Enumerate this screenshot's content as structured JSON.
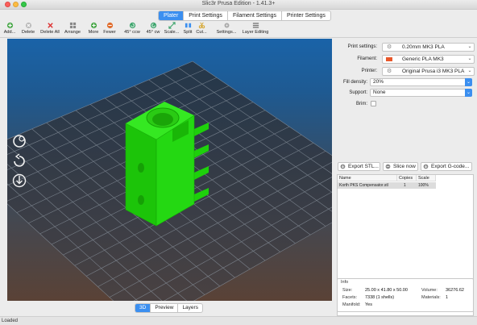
{
  "window": {
    "title": "Slic3r Prusa Edition - 1.41.3+"
  },
  "tabs": [
    {
      "label": "Plater",
      "active": true
    },
    {
      "label": "Print Settings",
      "active": false
    },
    {
      "label": "Filament Settings",
      "active": false
    },
    {
      "label": "Printer Settings",
      "active": false
    }
  ],
  "toolbar": [
    {
      "label": "Add...",
      "icon": "add-icon"
    },
    {
      "label": "Delete",
      "icon": "delete-icon"
    },
    {
      "label": "Delete All",
      "icon": "delete-all-icon"
    },
    {
      "label": "Arrange",
      "icon": "arrange-icon"
    },
    {
      "label": "More",
      "icon": "more-icon"
    },
    {
      "label": "Fewer",
      "icon": "fewer-icon"
    },
    {
      "label": "45° ccw",
      "icon": "rotate-ccw-icon"
    },
    {
      "label": "45° cw",
      "icon": "rotate-cw-icon"
    },
    {
      "label": "Scale...",
      "icon": "scale-icon"
    },
    {
      "label": "Split",
      "icon": "split-icon"
    },
    {
      "label": "Cut...",
      "icon": "cut-icon"
    },
    {
      "label": "Settings...",
      "icon": "settings-icon"
    },
    {
      "label": "Layer Editing",
      "icon": "layer-editing-icon"
    }
  ],
  "view_tabs": [
    {
      "label": "3D",
      "active": true
    },
    {
      "label": "Preview",
      "active": false
    },
    {
      "label": "Layers",
      "active": false
    }
  ],
  "status": "Loaded",
  "settings": {
    "print_label": "Print settings:",
    "print_value": "0.20mm MK3 PLA",
    "filament_label": "Filament:",
    "filament_value": "Generic PLA MK3",
    "filament_color": "#e8572a",
    "printer_label": "Printer:",
    "printer_value": "Original Prusa i3 MK3 PLA",
    "fill_label": "Fill density:",
    "fill_value": "20%",
    "support_label": "Support:",
    "support_value": "None",
    "brim_label": "Brim:",
    "brim_checked": false
  },
  "actions": {
    "export_stl": "Export STL...",
    "slice_now": "Slice now",
    "export_gcode": "Export G-code..."
  },
  "objects": {
    "headers": [
      "Name",
      "Copies",
      "Scale"
    ],
    "rows": [
      {
        "name": "Korth PKS Compensator.stl",
        "copies": "1",
        "scale": "100%"
      }
    ]
  },
  "info": {
    "title": "Info",
    "size_label": "Size:",
    "size_value": "25.00 x 41.80 x 50.00",
    "volume_label": "Volume:",
    "volume_value": "36276.62",
    "facets_label": "Facets:",
    "facets_value": "7338 (1 shells)",
    "materials_label": "Materials:",
    "materials_value": "1",
    "manifold_label": "Manifold:",
    "manifold_value": "Yes"
  },
  "colors": {
    "accent": "#3b8ff0",
    "model": "#22d40c"
  }
}
